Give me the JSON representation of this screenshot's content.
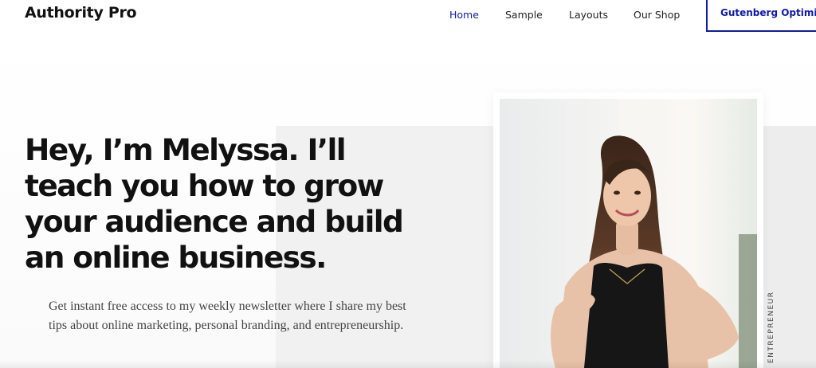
{
  "header": {
    "logo": "Authority Pro",
    "nav": [
      {
        "label": "Home",
        "active": true
      },
      {
        "label": "Sample",
        "active": false
      },
      {
        "label": "Layouts",
        "active": false
      },
      {
        "label": "Our Shop",
        "active": false
      }
    ],
    "cta_label": "Gutenberg Optimized"
  },
  "hero": {
    "headline": "Hey, I’m Melyssa. I’ll teach you how to grow your audience and build an online business.",
    "subtext": "Get instant free access to my weekly newsletter where I share my best tips about online marketing, personal branding, and entrepreneurship.",
    "vertical_label": "ENTREPRENEUR"
  },
  "colors": {
    "accent": "#0e1ba8",
    "text": "#111111",
    "panel": "#f1f1f1"
  }
}
